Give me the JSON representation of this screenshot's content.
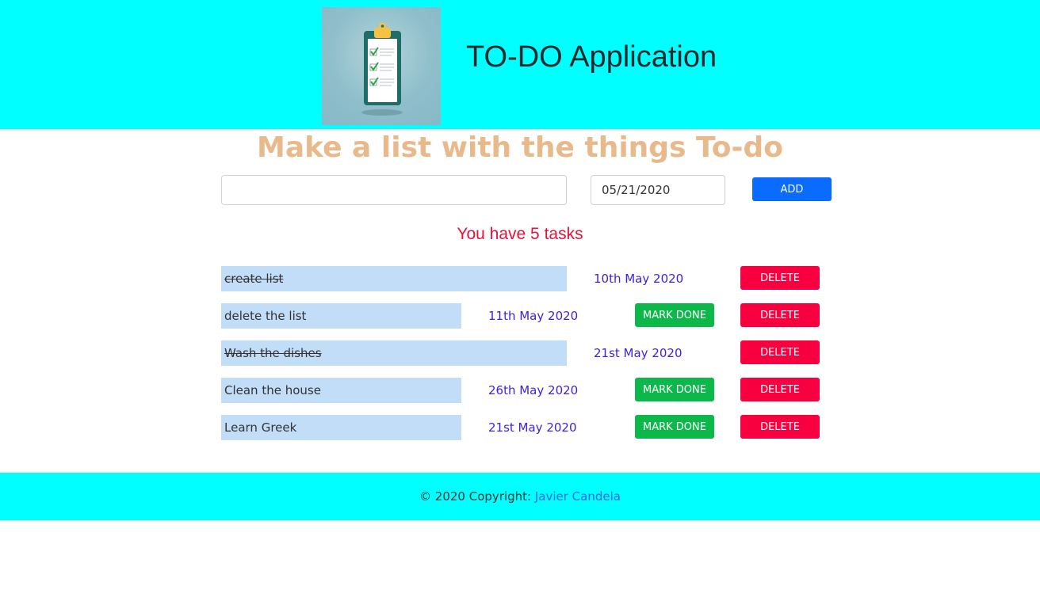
{
  "header": {
    "logo_icon": "clipboard-checklist-icon",
    "title": "TO-DO Application"
  },
  "main": {
    "subtitle": "Make a list with the things To-do",
    "task_input": {
      "value": "",
      "placeholder": ""
    },
    "date_input": {
      "value": "05/21/2020"
    },
    "add_label": "ADD",
    "count_text": "You have 5 tasks"
  },
  "tasks": [
    {
      "text": "create list",
      "date": "10th May 2020",
      "done": true
    },
    {
      "text": "delete the list",
      "date": "11th May 2020",
      "done": false
    },
    {
      "text": "Wash the dishes",
      "date": "21st May 2020",
      "done": true
    },
    {
      "text": "Clean the house",
      "date": "26th May 2020",
      "done": false
    },
    {
      "text": "Learn Greek",
      "date": "21st May 2020",
      "done": false
    }
  ],
  "labels": {
    "mark_done": "MARK DONE",
    "delete": "DELETE"
  },
  "footer": {
    "copyright": "© 2020 Copyright: ",
    "author": "Javier Candela"
  },
  "colors": {
    "header_bg": "#00ffff",
    "subtitle": "#e8b98a",
    "count": "#e8113a",
    "task_bg": "#c2ddf8",
    "date": "#3d1fe0",
    "add": "#0a6cff",
    "mark_done": "#0cb84a",
    "delete": "#f8003f"
  }
}
